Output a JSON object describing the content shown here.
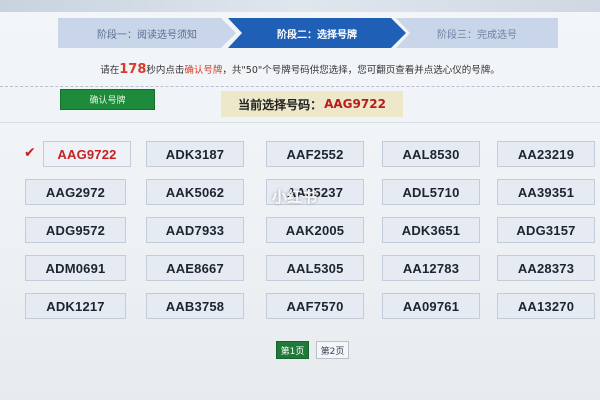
{
  "steps": [
    {
      "label": "阶段一：阅读选号须知"
    },
    {
      "label": "阶段二：选择号牌"
    },
    {
      "label": "阶段三：完成选号"
    }
  ],
  "notice": {
    "prefix": "请在",
    "seconds": "178",
    "mid": "秒内点击",
    "action": "确认号牌",
    "suffix": "，共\"50\"个号牌号码供您选择，您可翻页查看并点选心仪的号牌。"
  },
  "confirm_button": "确认号牌",
  "current": {
    "label": "当前选择号码：",
    "value": "AAG9722"
  },
  "plates": [
    [
      "AAG9722",
      "ADK3187",
      "AAF2552",
      "AAL8530",
      "AA23219"
    ],
    [
      "AAG2972",
      "AAK5062",
      "AA35237",
      "ADL5710",
      "AA39351"
    ],
    [
      "ADG9572",
      "AAD7933",
      "AAK2005",
      "ADK3651",
      "ADG3157"
    ],
    [
      "ADM0691",
      "AAE8667",
      "AAL5305",
      "AA12783",
      "AA28373"
    ],
    [
      "ADK1217",
      "AAB3758",
      "AAF7570",
      "AA09761",
      "AA13270"
    ]
  ],
  "selected_plate": "AAG9722",
  "pagination": {
    "page1": "第1页",
    "page2": "第2页",
    "current_page": 1
  },
  "watermark": "小红书",
  "colors": {
    "accent_blue": "#1f5fb6",
    "selected_red": "#c62020",
    "button_green": "#1e8a3c"
  }
}
